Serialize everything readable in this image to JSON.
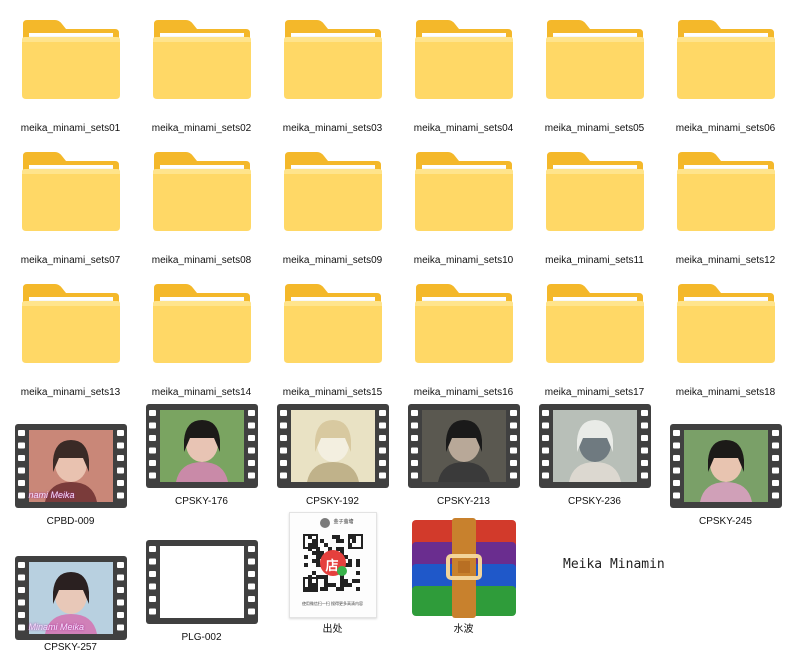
{
  "folders": [
    {
      "label": "meika_minami_sets01"
    },
    {
      "label": "meika_minami_sets02"
    },
    {
      "label": "meika_minami_sets03"
    },
    {
      "label": "meika_minami_sets04"
    },
    {
      "label": "meika_minami_sets05"
    },
    {
      "label": "meika_minami_sets06"
    },
    {
      "label": "meika_minami_sets07"
    },
    {
      "label": "meika_minami_sets08"
    },
    {
      "label": "meika_minami_sets09"
    },
    {
      "label": "meika_minami_sets10"
    },
    {
      "label": "meika_minami_sets11"
    },
    {
      "label": "meika_minami_sets12"
    },
    {
      "label": "meika_minami_sets13"
    },
    {
      "label": "meika_minami_sets14"
    },
    {
      "label": "meika_minami_sets15"
    },
    {
      "label": "meika_minami_sets16"
    },
    {
      "label": "meika_minami_sets17"
    },
    {
      "label": "meika_minami_sets18"
    }
  ],
  "videos": [
    {
      "label": "CPBD-009",
      "overlay_text": "nami Meika"
    },
    {
      "label": "CPSKY-176",
      "overlay_text": ""
    },
    {
      "label": "CPSKY-192",
      "overlay_text": ""
    },
    {
      "label": "CPSKY-213",
      "overlay_text": ""
    },
    {
      "label": "CPSKY-236",
      "overlay_text": ""
    },
    {
      "label": "CPSKY-245",
      "overlay_text": ""
    },
    {
      "label": "CPSKY-257",
      "overlay_text": "Minami Meika"
    },
    {
      "label": "PLG-002",
      "overlay_text": ""
    }
  ],
  "image_file": {
    "label": "出处",
    "store_char": "店",
    "top_name": "金子萤塘",
    "caption": "使用微信扫一扫 搜得更多高清内容"
  },
  "archive_file": {
    "label": "水波"
  },
  "side_text": "Meika Minamin",
  "colors": {
    "folder_back": "#f4b82a",
    "folder_front": "#ffd866",
    "film_border": "#404040",
    "rar_purple": "#6a2d8f",
    "rar_blue": "#1f58c9",
    "rar_green": "#2f9c3a",
    "rar_red": "#d23a2b",
    "rar_strap": "#c8812d"
  }
}
